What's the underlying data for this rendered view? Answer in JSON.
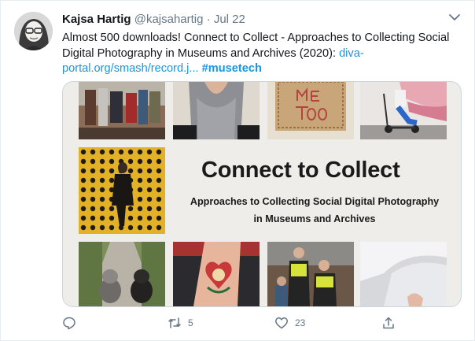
{
  "tweet": {
    "author_name": "Kajsa Hartig",
    "handle": "@kajsahartig",
    "separator": "·",
    "date": "Jul 22",
    "text_main": "Almost 500 downloads! Connect to Collect - Approaches to Collecting Social Digital Photography in Museums and Archives (2020): ",
    "link_text": "diva-portal.org/smash/record.j...",
    "hashtag": "#musetech"
  },
  "card": {
    "title": "Connect to Collect",
    "subtitle_line1": "Approaches to Collecting Social Digital Photography",
    "subtitle_line2": "in Museums and Archives"
  },
  "actions": {
    "reply_count": "",
    "retweet_count": "5",
    "like_count": "23"
  },
  "icons": {
    "chevron": "chevron-down-icon",
    "reply": "reply-icon",
    "retweet": "retweet-icon",
    "like": "heart-icon",
    "share": "share-icon"
  },
  "colors": {
    "link": "#1b95e0",
    "muted": "#657786",
    "card_bg": "#efede9",
    "border": "#ccd6dd"
  }
}
